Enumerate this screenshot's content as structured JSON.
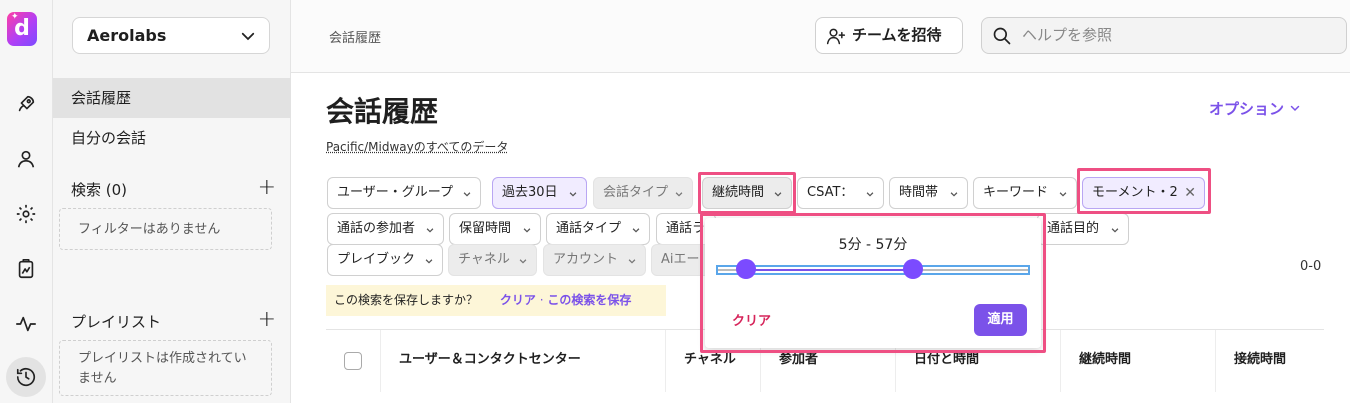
{
  "workspace": {
    "name": "Aerolabs"
  },
  "sidebar": {
    "items": [
      {
        "label": "会話履歴",
        "active": true
      },
      {
        "label": "自分の会話",
        "active": false
      }
    ],
    "search_heading": "検索 (0)",
    "search_empty": "フィルターはありません",
    "playlist_heading": "プレイリスト",
    "playlist_empty": "プレイリストは作成されていません"
  },
  "topbar": {
    "breadcrumb": "会話履歴",
    "invite_label": "チームを招待",
    "search_placeholder": "ヘルプを参照"
  },
  "main": {
    "title": "会話履歴",
    "subtitle": "Pacific/Midwayのすべてのデータ",
    "options_label": "オプション",
    "filters": {
      "row1": [
        "ユーザー・グループ",
        "過去30日",
        "会話タイプ",
        "継続時間",
        "CSAT：",
        "時間帯",
        "キーワード",
        "モーメント・2"
      ],
      "row2": [
        "通話の参加者",
        "保留時間",
        "通話タイプ",
        "通話ラ",
        "通話目的"
      ],
      "row3": [
        "プレイブック",
        "チャネル",
        "アカウント",
        "Aiエー"
      ]
    },
    "save_prompt": "この検索を保存しますか？",
    "save_clear": "クリア",
    "save_sep": "·",
    "save_action": "この検索を保存",
    "result_count": "0-0",
    "table_headers": [
      "ユーザー＆コンタクトセンター",
      "チャネル",
      "参加者",
      "日付と時間",
      "継続時間",
      "接続時間"
    ]
  },
  "duration_popup": {
    "range_label": "5分 - 57分",
    "range_fraction": [
      0.09,
      0.63
    ],
    "clear_label": "クリア",
    "apply_label": "適用"
  },
  "colors": {
    "accent": "#7b52e9",
    "highlight": "#ee4f83",
    "danger": "#d6245a"
  }
}
